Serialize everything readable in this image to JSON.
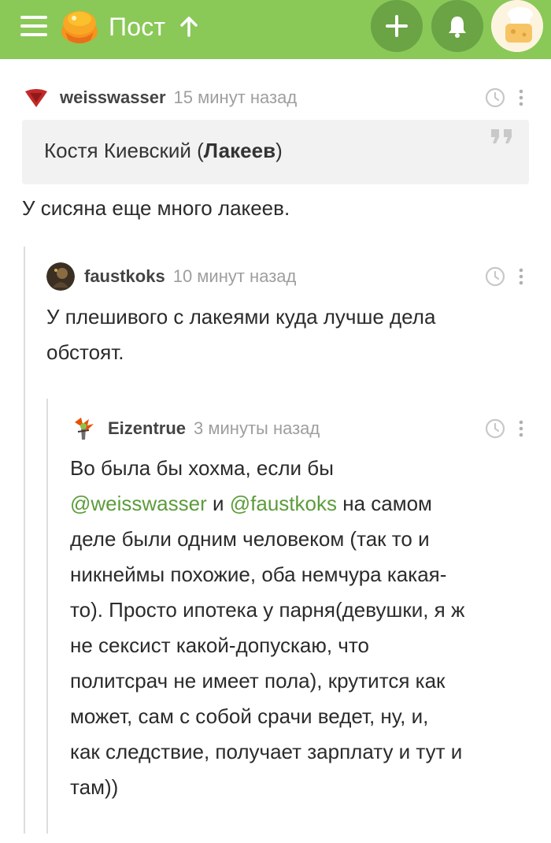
{
  "header": {
    "title": "Пост",
    "colors": {
      "bar": "#8ac858",
      "button": "#6aa444"
    },
    "icons": [
      "menu-icon",
      "logo-icon",
      "arrow-up-icon",
      "plus-icon",
      "bell-icon",
      "user-avatar"
    ]
  },
  "comments": [
    {
      "user": "weisswasser",
      "time": "15 минут назад",
      "quote": {
        "name": "Костя Киевский (",
        "bold": "Лакеев",
        "end": ")"
      },
      "text": "У сисяна еще много лакеев."
    },
    {
      "user": "faustkoks",
      "time": "10 минут назад",
      "lines": [
        "У плешивого с лакеями куда лучше дела",
        "обстоят."
      ]
    },
    {
      "user": "Eizentrue",
      "time": "3 минуты назад",
      "line1": "Во была бы хохма, если бы",
      "mention1": "@weisswasser",
      "and": " и ",
      "mention2": "@faustkoks",
      "after_mentions": " на самом",
      "lines": [
        "деле были одним человеком (так то и",
        "никнеймы похожие, оба немчура какая-",
        "то). Просто ипотека у парня(девушки, я ж",
        "не сексист какой-допускаю, что",
        "политсрач не имеет пола), крутится как",
        "может, сам с собой срачи ведет, ну, и,",
        "как следствие, получает зарплату и тут и",
        "там))"
      ]
    }
  ],
  "colors": {
    "mention": "#5c9c3c",
    "meta": "#9e9e9e",
    "quote_bg": "#f2f2f2"
  }
}
